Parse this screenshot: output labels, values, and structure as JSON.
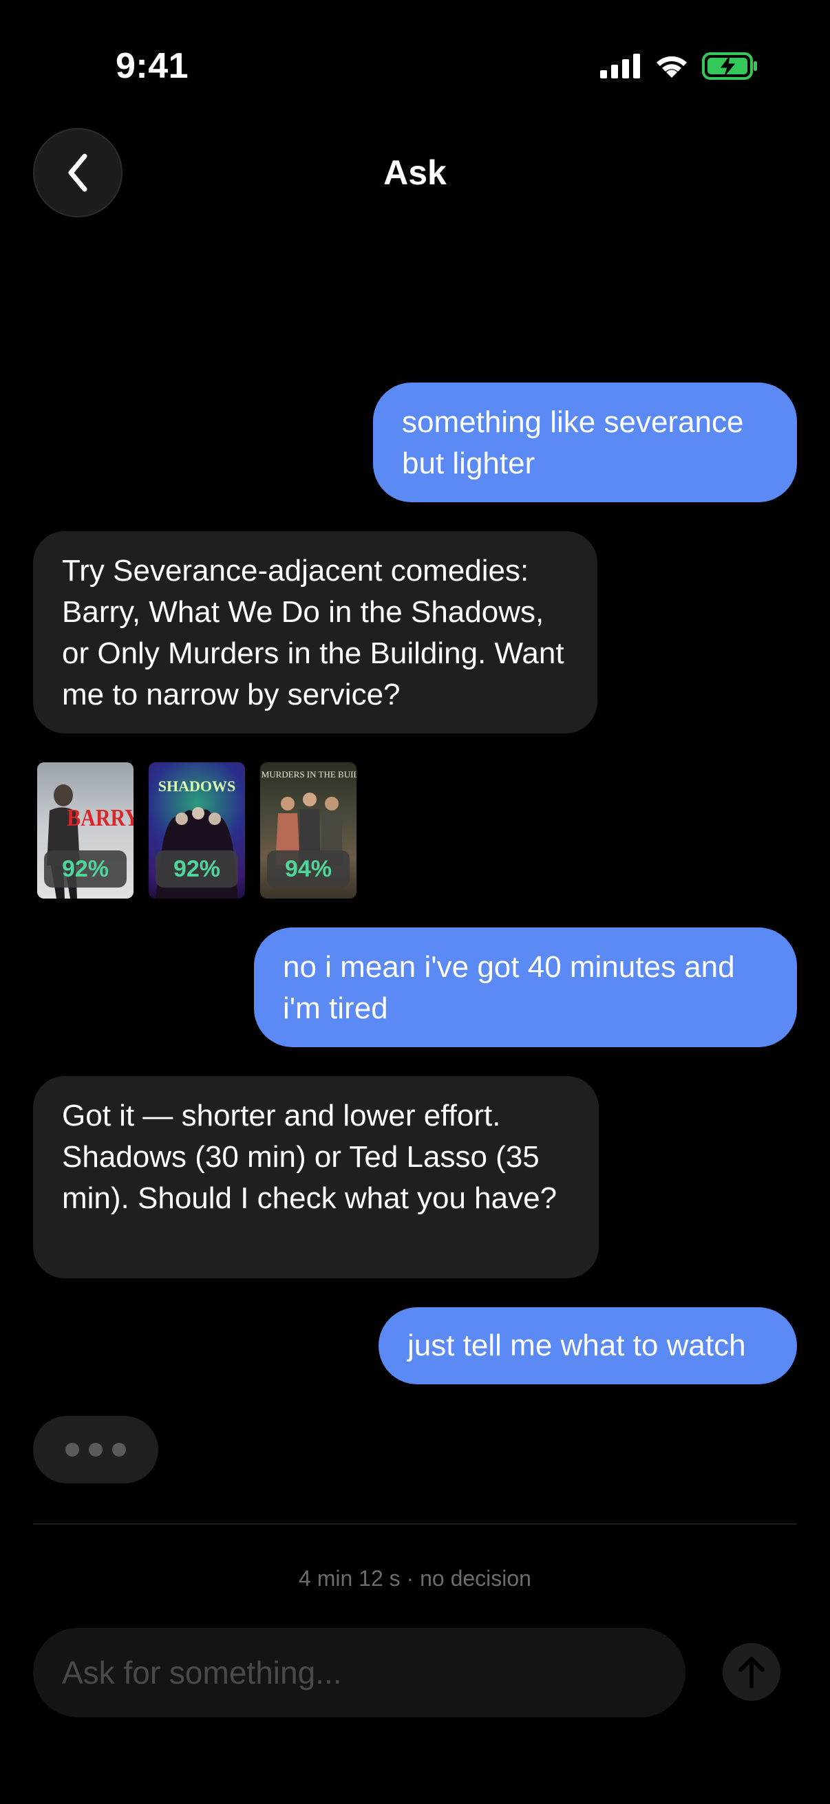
{
  "status_bar": {
    "time": "9:41"
  },
  "header": {
    "title": "Ask",
    "back_icon": "chevron-left-icon"
  },
  "messages": [
    {
      "role": "user",
      "text": "something like severance but lighter"
    },
    {
      "role": "assistant",
      "text": "Try Severance-adjacent comedies: Barry, What We Do in the Shadows, or Only Murders in the Building. Want me to narrow by service?"
    },
    {
      "role": "user",
      "text": "no i mean i've got 40 minutes and i'm tired"
    },
    {
      "role": "assistant",
      "text": "Got it — shorter and lower effort. Shadows (30 min) or Ted Lasso (35 min). Should I check what you have?"
    },
    {
      "role": "user",
      "text": "just tell me what to watch"
    }
  ],
  "recommendations": [
    {
      "poster_text": "BARRY",
      "score": "92%"
    },
    {
      "poster_text": "SHADOWS",
      "score": "92%"
    },
    {
      "poster_text": "ONLY MURDERS IN THE BUILDING",
      "score": "94%"
    }
  ],
  "session_info": "4 min 12 s · no decision",
  "composer": {
    "placeholder": "Ask for something...",
    "send_icon": "arrow-up-icon"
  },
  "colors": {
    "user_bubble": "#5b8af5",
    "assistant_bubble": "#1f1f21",
    "score_text": "#4fd69c",
    "battery": "#34c759"
  }
}
